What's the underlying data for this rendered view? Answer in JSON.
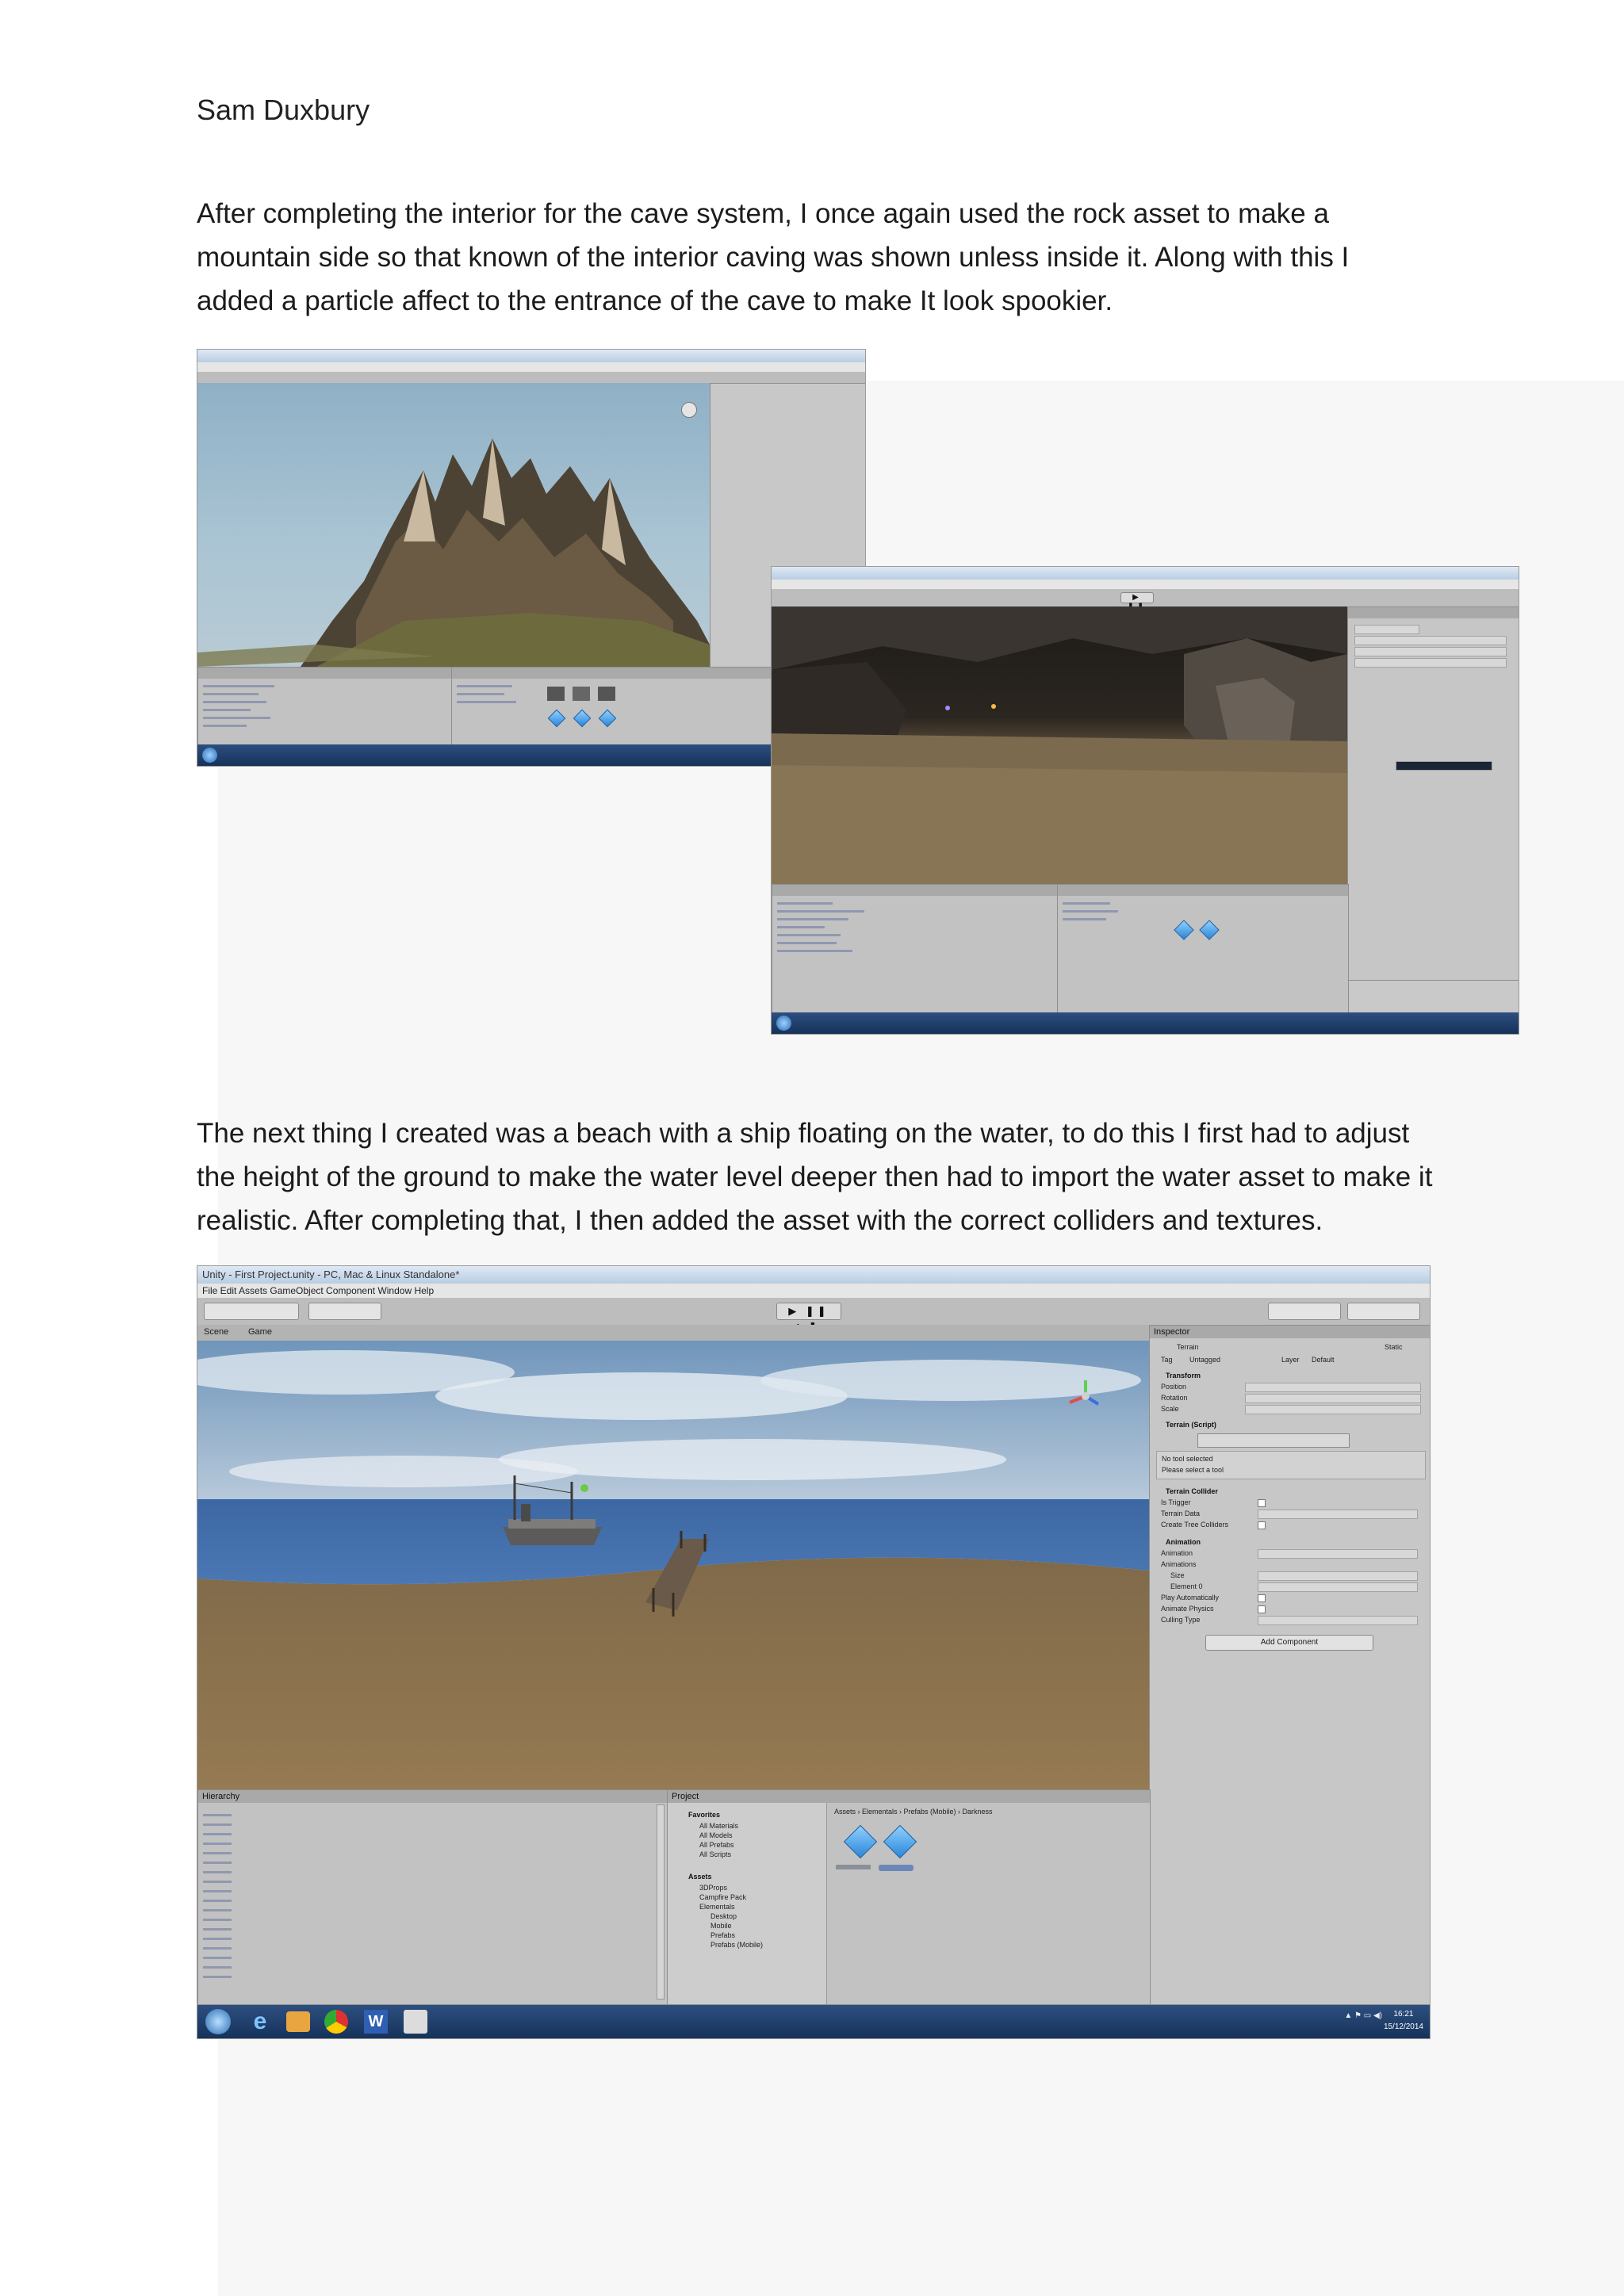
{
  "author": "Sam Duxbury",
  "paragraph_1": "After completing the interior for the cave system, I once again used the rock asset to make a mountain side so that known of the interior caving was shown unless inside it. Along with this I added a particle affect to the entrance of the cave to make It look spookier.",
  "paragraph_2": "The next thing I created was a beach with a ship floating on the water, to do this I first had to adjust the height of the ground to make the water level deeper then had to import the water asset to make it realistic. After completing that, I then added the asset with the correct colliders and textures.",
  "screenshot_3": {
    "window_title": "Unity - First Project.unity - PC, Mac & Linux Standalone*",
    "menu": "File   Edit   Assets   GameObject   Component   Window   Help",
    "scene_tab": "Scene",
    "game_tab": "Game",
    "inspector": {
      "title": "Inspector",
      "object_name": "Terrain",
      "static_label": "Static",
      "tag_label": "Tag",
      "tag_value": "Untagged",
      "layer_label": "Layer",
      "layer_value": "Default",
      "transform_header": "Transform",
      "position_label": "Position",
      "rotation_label": "Rotation",
      "scale_label": "Scale",
      "terrain_script_header": "Terrain (Script)",
      "no_tool_selected": "No tool selected",
      "select_tool_hint": "Please select a tool",
      "terrain_collider_header": "Terrain Collider",
      "is_trigger_label": "Is Trigger",
      "terrain_data_label": "Terrain Data",
      "create_tree_colliders_label": "Create Tree Colliders",
      "animation_header": "Animation",
      "animation_label": "Animation",
      "animations_label": "Animations",
      "size_label": "Size",
      "element_label": "Element 0",
      "play_auto_label": "Play Automatically",
      "animate_physics_label": "Animate Physics",
      "culling_type_label": "Culling Type",
      "add_component": "Add Component"
    },
    "hierarchy_title": "Hierarchy",
    "project_title": "Project",
    "favorites_label": "Favorites",
    "favorites": [
      "All Materials",
      "All Models",
      "All Prefabs",
      "All Scripts"
    ],
    "assets_label": "Assets",
    "asset_folders": [
      "3DProps",
      "Campfire Pack",
      "Elementals",
      "Desktop",
      "Mobile",
      "Prefabs",
      "Prefabs (Mobile)"
    ],
    "breadcrumb": "Assets › Elementals › Prefabs (Mobile) › Darkness",
    "clock": "16:21",
    "date": "15/12/2014"
  },
  "colors": {
    "sky_top": "#7aa0c2",
    "water": "#3f6aa5",
    "sand": "#8e7450",
    "taskbar": "#1d3b66"
  }
}
